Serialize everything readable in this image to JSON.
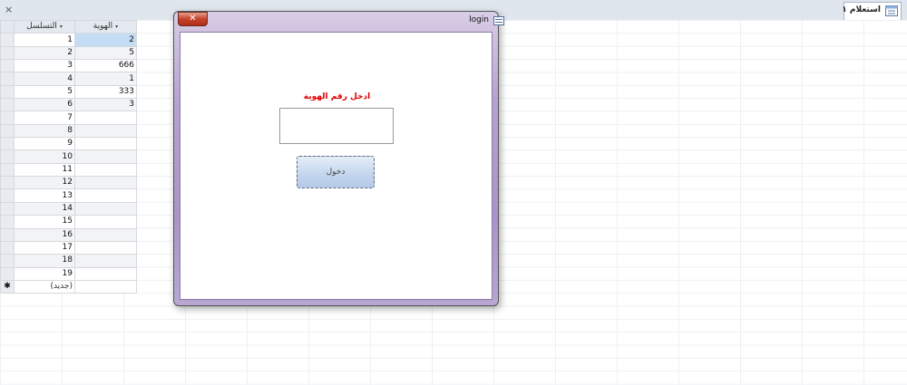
{
  "tab": {
    "label": "استعلام ١",
    "close_glyph": "×",
    "icon": "query-icon"
  },
  "datasheet": {
    "columns": {
      "seq": "التسلسل",
      "id": "الهوية",
      "dropdown_glyph": "▾"
    },
    "rows": [
      {
        "seq": "1",
        "id": "2"
      },
      {
        "seq": "2",
        "id": "5"
      },
      {
        "seq": "3",
        "id": "666"
      },
      {
        "seq": "4",
        "id": "1"
      },
      {
        "seq": "5",
        "id": "333"
      },
      {
        "seq": "6",
        "id": "3"
      },
      {
        "seq": "7",
        "id": ""
      },
      {
        "seq": "8",
        "id": ""
      },
      {
        "seq": "9",
        "id": ""
      },
      {
        "seq": "10",
        "id": ""
      },
      {
        "seq": "11",
        "id": ""
      },
      {
        "seq": "12",
        "id": ""
      },
      {
        "seq": "13",
        "id": ""
      },
      {
        "seq": "14",
        "id": ""
      },
      {
        "seq": "15",
        "id": ""
      },
      {
        "seq": "16",
        "id": ""
      },
      {
        "seq": "17",
        "id": ""
      },
      {
        "seq": "18",
        "id": ""
      },
      {
        "seq": "19",
        "id": ""
      }
    ],
    "new_row": {
      "marker": "✱",
      "seq": "(جديد)"
    }
  },
  "login": {
    "title": "login",
    "close_glyph": "✕",
    "prompt": "ادخل رقم الهوية",
    "id_value": "",
    "enter_label": "دخول"
  },
  "colors": {
    "prompt": "#e00000",
    "selected_cell": "#c5dcf5",
    "window_frame": "#a994c7",
    "close_button": "#c6412a"
  }
}
